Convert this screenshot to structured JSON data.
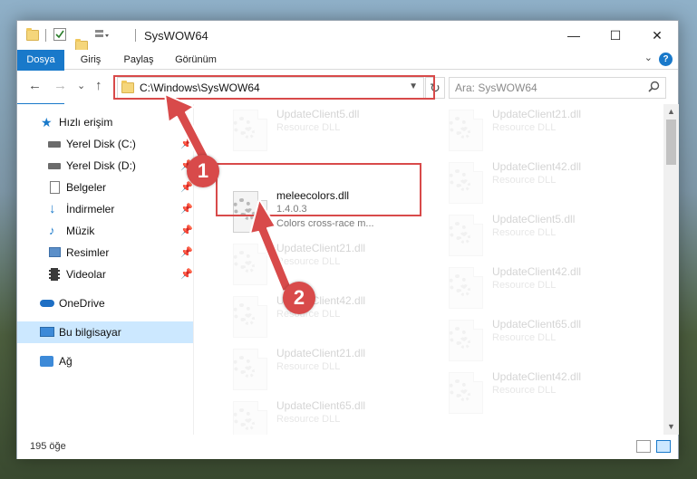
{
  "window": {
    "title": "SysWOW64",
    "controls": {
      "minimize": "—",
      "maximize": "☐",
      "close": "✕"
    }
  },
  "ribbon": {
    "tabs": [
      "Dosya",
      "Giriş",
      "Paylaş",
      "Görünüm"
    ],
    "help": "?",
    "collapse": "⌄"
  },
  "nav": {
    "back": "←",
    "forward": "→",
    "recent": "⌄",
    "up": "↑",
    "address": "C:\\Windows\\SysWOW64",
    "refresh": "↻",
    "search_placeholder": "Ara: SysWOW64",
    "search_icon": "⚲"
  },
  "sidebar": {
    "items": [
      {
        "label": "Hızlı erişim",
        "icon": "star-icon",
        "pinned": false
      },
      {
        "label": "Yerel Disk (C:)",
        "icon": "drive-icon",
        "pinned": true
      },
      {
        "label": "Yerel Disk (D:)",
        "icon": "drive-icon",
        "pinned": true
      },
      {
        "label": "Belgeler",
        "icon": "documents-icon",
        "pinned": true
      },
      {
        "label": "İndirmeler",
        "icon": "downloads-icon",
        "pinned": true
      },
      {
        "label": "Müzik",
        "icon": "music-icon",
        "pinned": true
      },
      {
        "label": "Resimler",
        "icon": "pictures-icon",
        "pinned": true
      },
      {
        "label": "Videolar",
        "icon": "videos-icon",
        "pinned": true
      },
      {
        "label": "OneDrive",
        "icon": "cloud-icon",
        "pinned": false
      },
      {
        "label": "Bu bilgisayar",
        "icon": "computer-icon",
        "pinned": false
      },
      {
        "label": "Ağ",
        "icon": "network-icon",
        "pinned": false
      }
    ]
  },
  "files": {
    "highlighted": {
      "name": "meleecolors.dll",
      "version": "1.4.0.3",
      "description": "Colors cross-race m..."
    },
    "left_column": [
      {
        "name": "UpdateClient5.dll",
        "type": "Resource DLL"
      },
      {
        "name": "UpdateClient21.dll",
        "type": "Resource DLL"
      },
      {
        "name": "UpdateClient42.dll",
        "type": "Resource DLL"
      },
      {
        "name": "UpdateClient21.dll",
        "type": "Resource DLL"
      },
      {
        "name": "UpdateClient65.dll",
        "type": "Resource DLL"
      }
    ],
    "right_column": [
      {
        "name": "UpdateClient21.dll",
        "type": "Resource DLL"
      },
      {
        "name": "UpdateClient42.dll",
        "type": "Resource DLL"
      },
      {
        "name": "UpdateClient5.dll",
        "type": "Resource DLL"
      },
      {
        "name": "UpdateClient42.dll",
        "type": "Resource DLL"
      },
      {
        "name": "UpdateClient65.dll",
        "type": "Resource DLL"
      },
      {
        "name": "UpdateClient42.dll",
        "type": "Resource DLL"
      }
    ]
  },
  "status": {
    "count": "195 öğe"
  },
  "annotations": {
    "step1": "1",
    "step2": "2",
    "color": "#d84a4a"
  }
}
